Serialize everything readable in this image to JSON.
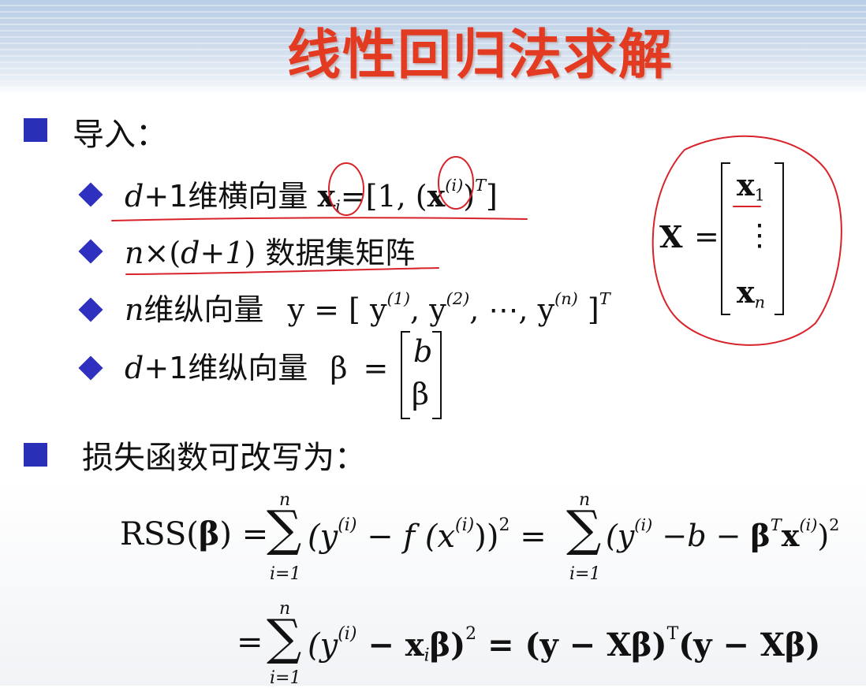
{
  "title": "线性回归法求解",
  "intro": {
    "label": "导入：",
    "items": [
      {
        "prefix": "d",
        "mid": "+1维横向量",
        "vec": "x",
        "sub": "i",
        "eq": "=[1, (",
        "vec2": "x",
        "sup": "(i)",
        "close": ")",
        "supT": "T",
        "end": "]"
      },
      {
        "prefix": "n",
        "mid": "×(",
        "d": "d",
        "plus": "+",
        "one": "1",
        "close": ")",
        "cn": " 数据集矩阵"
      },
      {
        "prefix": "n",
        "cn": "维纵向量",
        "eq": "y = [ y",
        "sup1": "(1)",
        "y2": ", y",
        "sup2": "(2)",
        "dots": ", ⋯, y",
        "supn": "(n)",
        "end": " ]",
        "supT": "T"
      },
      {
        "prefix": "d",
        "mid": "+1维纵向量",
        "beta": "β",
        "eq": "=",
        "m1": "b",
        "m2": "β"
      }
    ]
  },
  "matrixX": {
    "lhs": "X",
    "eq": "=",
    "row1": "x",
    "row1sub": "1",
    "dots": "⋮",
    "rown": "x",
    "rownsub": "n"
  },
  "loss": {
    "label": "损失函数可改写为：",
    "rss": "RSS(",
    "beta": "β",
    "rssClose": ")",
    "eq": "=",
    "sumTop": "n",
    "sumBottom": "i=1",
    "sigma": "∑",
    "term1a": "(y",
    "sup_i": "(i)",
    "term1b": " − f (x",
    "term1c": "))",
    "sq": "2",
    "term2a": "(y",
    "term2b": " −b − ",
    "betaT": "β",
    "T": "T",
    "term2c": "x",
    "term2d": ")",
    "line2a": "(y",
    "line2b": " − x",
    "line2sub": "i",
    "line2c": "β)",
    "line2d": " = (y − Xβ)",
    "line2T": "T",
    "line2e": "(y − Xβ)"
  }
}
